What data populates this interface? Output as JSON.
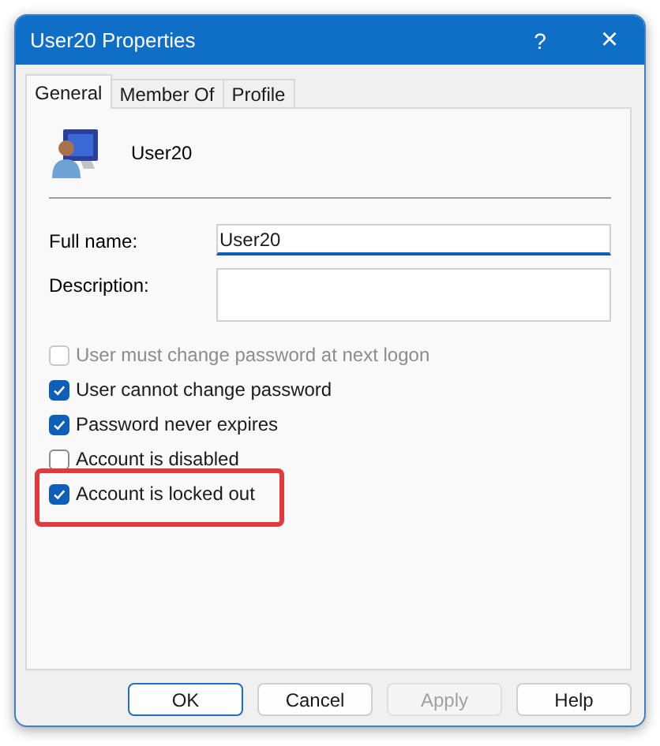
{
  "window": {
    "title": "User20 Properties",
    "help_button": "?",
    "close_button": "×"
  },
  "tabs": [
    {
      "label": "General",
      "selected": true
    },
    {
      "label": "Member Of",
      "selected": false
    },
    {
      "label": "Profile",
      "selected": false
    }
  ],
  "user": {
    "name": "User20"
  },
  "fields": [
    {
      "label": "Full name:",
      "value": "User20",
      "focused": true,
      "kind": "line"
    },
    {
      "label": "Description:",
      "focused": false,
      "kind": "box"
    }
  ],
  "options": [
    {
      "label": "User must change password at next logon",
      "checked": false,
      "disabled": true,
      "highlighted": false
    },
    {
      "label": "User cannot change password",
      "checked": true,
      "disabled": false,
      "highlighted": false
    },
    {
      "label": "Password never expires",
      "checked": true,
      "disabled": false,
      "highlighted": false
    },
    {
      "label": "Account is disabled",
      "checked": false,
      "disabled": false,
      "highlighted": false
    },
    {
      "label": "Account is locked out",
      "checked": true,
      "disabled": false,
      "highlighted": true
    }
  ],
  "buttons": [
    {
      "label": "OK",
      "default": true,
      "disabled": false
    },
    {
      "label": "Cancel",
      "default": false,
      "disabled": false
    },
    {
      "label": "Apply",
      "default": false,
      "disabled": true
    },
    {
      "label": "Help",
      "default": false,
      "disabled": false
    }
  ]
}
